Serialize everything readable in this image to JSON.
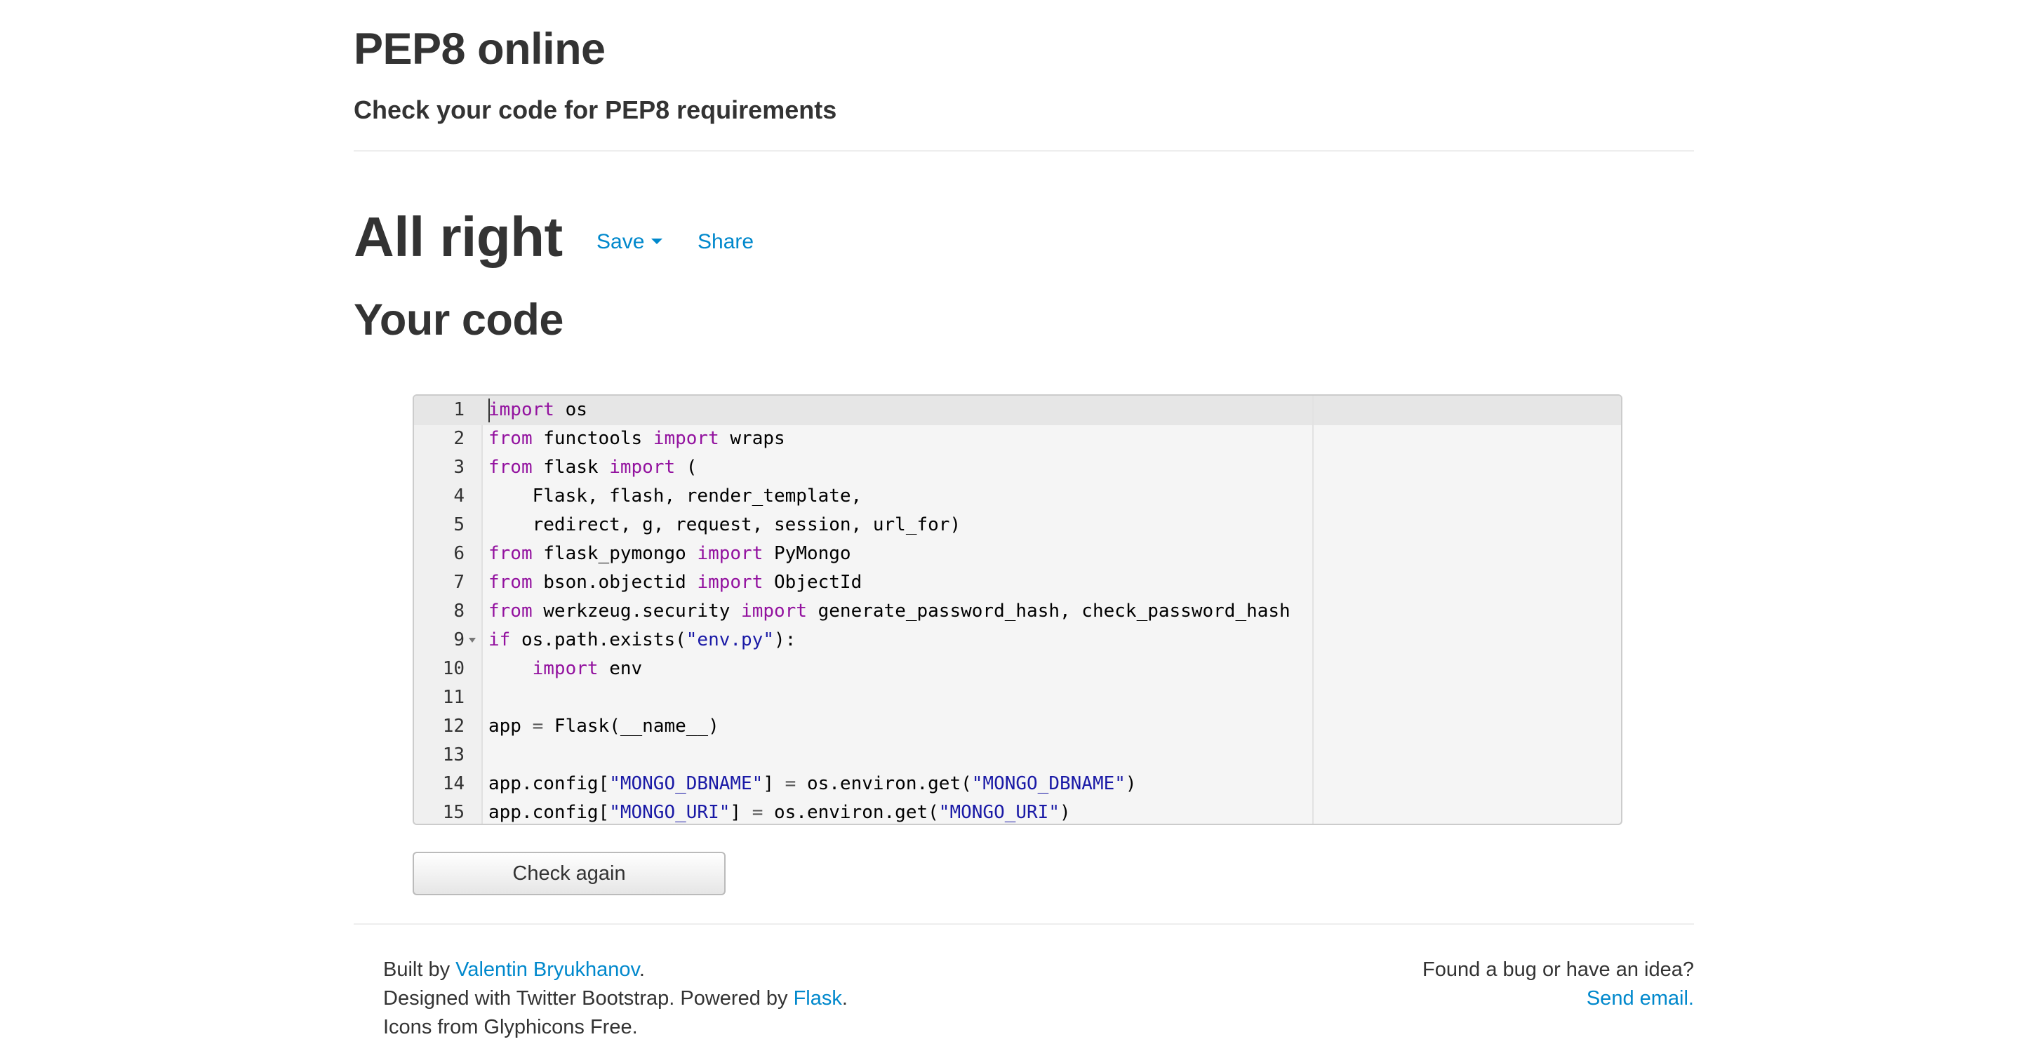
{
  "header": {
    "title": "PEP8 online",
    "subtitle": "Check your code for PEP8 requirements"
  },
  "result": {
    "title": "All right",
    "save_label": "Save",
    "share_label": "Share"
  },
  "code_section": {
    "heading": "Your code",
    "lines": [
      {
        "n": "1"
      },
      {
        "n": "2"
      },
      {
        "n": "3"
      },
      {
        "n": "4"
      },
      {
        "n": "5"
      },
      {
        "n": "6"
      },
      {
        "n": "7"
      },
      {
        "n": "8"
      },
      {
        "n": "9"
      },
      {
        "n": "10"
      },
      {
        "n": "11"
      },
      {
        "n": "12"
      },
      {
        "n": "13"
      },
      {
        "n": "14"
      },
      {
        "n": "15"
      }
    ],
    "tokens": {
      "import": "import",
      "from": "from",
      "if": "if",
      "os": " os",
      "functools": " functools ",
      "wraps": " wraps",
      "flask": " flask ",
      "paren_open": " (",
      "l4": "    Flask, flash, render_template,",
      "l5": "    redirect, g, request, session, url_for)",
      "flask_pymongo": " flask_pymongo ",
      "pymongo": " PyMongo",
      "bson": " bson.objectid ",
      "objectid": " ObjectId",
      "werkzeug": " werkzeug.security ",
      "hashes": " generate_password_hash, check_password_hash",
      "l9_a": " os.path.exists(",
      "l9_str": "\"env.py\"",
      "l9_b": "):",
      "indent": "    ",
      "env": " env",
      "l12_a": "app ",
      "eq": "=",
      "l12_b": " Flask(__name__)",
      "l14_a": "app.config[",
      "l14_str1": "\"MONGO_DBNAME\"",
      "l14_b": "] ",
      "l14_c": " os.environ.get(",
      "l14_str2": "\"MONGO_DBNAME\"",
      "close_paren": ")",
      "l15_a": "app.config[",
      "l15_str1": "\"MONGO_URI\"",
      "l15_b": "] ",
      "l15_c": " os.environ.get(",
      "l15_str2": "\"MONGO_URI\""
    },
    "check_button_label": "Check again"
  },
  "footer": {
    "built_by_prefix": "Built by ",
    "author_link": "Valentin Bryukhanov",
    "period": ".",
    "designed_prefix": "Designed with Twitter Bootstrap. Powered by ",
    "flask_link": "Flask",
    "icons_text": "Icons from Glyphicons Free.",
    "bug_text": "Found a bug or have an idea?",
    "email_link": "Send email."
  },
  "colors": {
    "link": "#0088cc",
    "keyword": "#93129f",
    "string": "#1a1aa6"
  }
}
